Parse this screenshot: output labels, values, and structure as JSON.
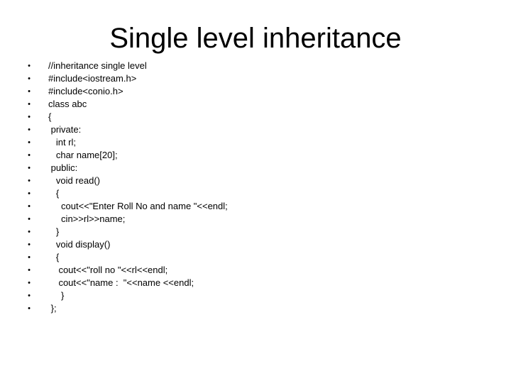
{
  "slide": {
    "title": "Single level inheritance",
    "bullet_glyph": "•",
    "code_lines": [
      "//inheritance single level",
      "#include<iostream.h>",
      "#include<conio.h>",
      "class abc",
      "{",
      " private:",
      "   int rl;",
      "   char name[20];",
      " public:",
      "   void read()",
      "   {",
      "     cout<<\"Enter Roll No and name \"<<endl;",
      "     cin>>rl>>name;",
      "   }",
      "   void display()",
      "   {",
      "    cout<<\"roll no \"<<rl<<endl;",
      "    cout<<\"name :  \"<<name <<endl;",
      "     }",
      " };"
    ]
  }
}
